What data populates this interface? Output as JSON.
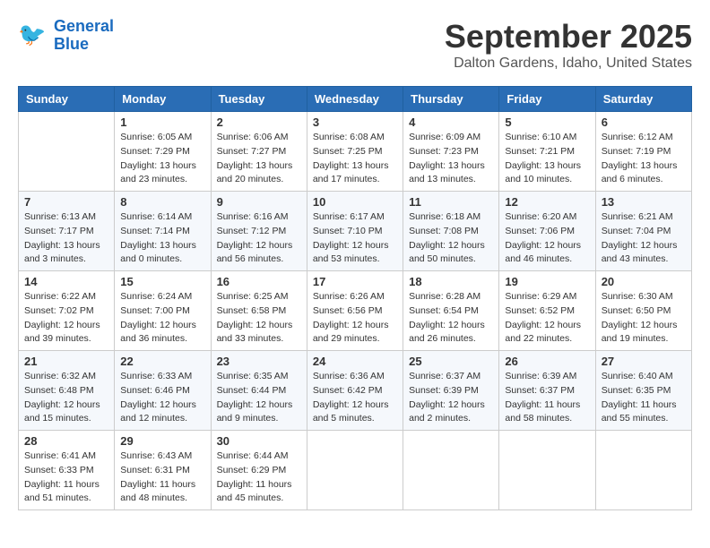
{
  "logo": {
    "line1": "General",
    "line2": "Blue"
  },
  "header": {
    "title": "September 2025",
    "location": "Dalton Gardens, Idaho, United States"
  },
  "weekdays": [
    "Sunday",
    "Monday",
    "Tuesday",
    "Wednesday",
    "Thursday",
    "Friday",
    "Saturday"
  ],
  "weeks": [
    [
      {
        "day": "",
        "info": ""
      },
      {
        "day": "1",
        "info": "Sunrise: 6:05 AM\nSunset: 7:29 PM\nDaylight: 13 hours\nand 23 minutes."
      },
      {
        "day": "2",
        "info": "Sunrise: 6:06 AM\nSunset: 7:27 PM\nDaylight: 13 hours\nand 20 minutes."
      },
      {
        "day": "3",
        "info": "Sunrise: 6:08 AM\nSunset: 7:25 PM\nDaylight: 13 hours\nand 17 minutes."
      },
      {
        "day": "4",
        "info": "Sunrise: 6:09 AM\nSunset: 7:23 PM\nDaylight: 13 hours\nand 13 minutes."
      },
      {
        "day": "5",
        "info": "Sunrise: 6:10 AM\nSunset: 7:21 PM\nDaylight: 13 hours\nand 10 minutes."
      },
      {
        "day": "6",
        "info": "Sunrise: 6:12 AM\nSunset: 7:19 PM\nDaylight: 13 hours\nand 6 minutes."
      }
    ],
    [
      {
        "day": "7",
        "info": "Sunrise: 6:13 AM\nSunset: 7:17 PM\nDaylight: 13 hours\nand 3 minutes."
      },
      {
        "day": "8",
        "info": "Sunrise: 6:14 AM\nSunset: 7:14 PM\nDaylight: 13 hours\nand 0 minutes."
      },
      {
        "day": "9",
        "info": "Sunrise: 6:16 AM\nSunset: 7:12 PM\nDaylight: 12 hours\nand 56 minutes."
      },
      {
        "day": "10",
        "info": "Sunrise: 6:17 AM\nSunset: 7:10 PM\nDaylight: 12 hours\nand 53 minutes."
      },
      {
        "day": "11",
        "info": "Sunrise: 6:18 AM\nSunset: 7:08 PM\nDaylight: 12 hours\nand 50 minutes."
      },
      {
        "day": "12",
        "info": "Sunrise: 6:20 AM\nSunset: 7:06 PM\nDaylight: 12 hours\nand 46 minutes."
      },
      {
        "day": "13",
        "info": "Sunrise: 6:21 AM\nSunset: 7:04 PM\nDaylight: 12 hours\nand 43 minutes."
      }
    ],
    [
      {
        "day": "14",
        "info": "Sunrise: 6:22 AM\nSunset: 7:02 PM\nDaylight: 12 hours\nand 39 minutes."
      },
      {
        "day": "15",
        "info": "Sunrise: 6:24 AM\nSunset: 7:00 PM\nDaylight: 12 hours\nand 36 minutes."
      },
      {
        "day": "16",
        "info": "Sunrise: 6:25 AM\nSunset: 6:58 PM\nDaylight: 12 hours\nand 33 minutes."
      },
      {
        "day": "17",
        "info": "Sunrise: 6:26 AM\nSunset: 6:56 PM\nDaylight: 12 hours\nand 29 minutes."
      },
      {
        "day": "18",
        "info": "Sunrise: 6:28 AM\nSunset: 6:54 PM\nDaylight: 12 hours\nand 26 minutes."
      },
      {
        "day": "19",
        "info": "Sunrise: 6:29 AM\nSunset: 6:52 PM\nDaylight: 12 hours\nand 22 minutes."
      },
      {
        "day": "20",
        "info": "Sunrise: 6:30 AM\nSunset: 6:50 PM\nDaylight: 12 hours\nand 19 minutes."
      }
    ],
    [
      {
        "day": "21",
        "info": "Sunrise: 6:32 AM\nSunset: 6:48 PM\nDaylight: 12 hours\nand 15 minutes."
      },
      {
        "day": "22",
        "info": "Sunrise: 6:33 AM\nSunset: 6:46 PM\nDaylight: 12 hours\nand 12 minutes."
      },
      {
        "day": "23",
        "info": "Sunrise: 6:35 AM\nSunset: 6:44 PM\nDaylight: 12 hours\nand 9 minutes."
      },
      {
        "day": "24",
        "info": "Sunrise: 6:36 AM\nSunset: 6:42 PM\nDaylight: 12 hours\nand 5 minutes."
      },
      {
        "day": "25",
        "info": "Sunrise: 6:37 AM\nSunset: 6:39 PM\nDaylight: 12 hours\nand 2 minutes."
      },
      {
        "day": "26",
        "info": "Sunrise: 6:39 AM\nSunset: 6:37 PM\nDaylight: 11 hours\nand 58 minutes."
      },
      {
        "day": "27",
        "info": "Sunrise: 6:40 AM\nSunset: 6:35 PM\nDaylight: 11 hours\nand 55 minutes."
      }
    ],
    [
      {
        "day": "28",
        "info": "Sunrise: 6:41 AM\nSunset: 6:33 PM\nDaylight: 11 hours\nand 51 minutes."
      },
      {
        "day": "29",
        "info": "Sunrise: 6:43 AM\nSunset: 6:31 PM\nDaylight: 11 hours\nand 48 minutes."
      },
      {
        "day": "30",
        "info": "Sunrise: 6:44 AM\nSunset: 6:29 PM\nDaylight: 11 hours\nand 45 minutes."
      },
      {
        "day": "",
        "info": ""
      },
      {
        "day": "",
        "info": ""
      },
      {
        "day": "",
        "info": ""
      },
      {
        "day": "",
        "info": ""
      }
    ]
  ]
}
